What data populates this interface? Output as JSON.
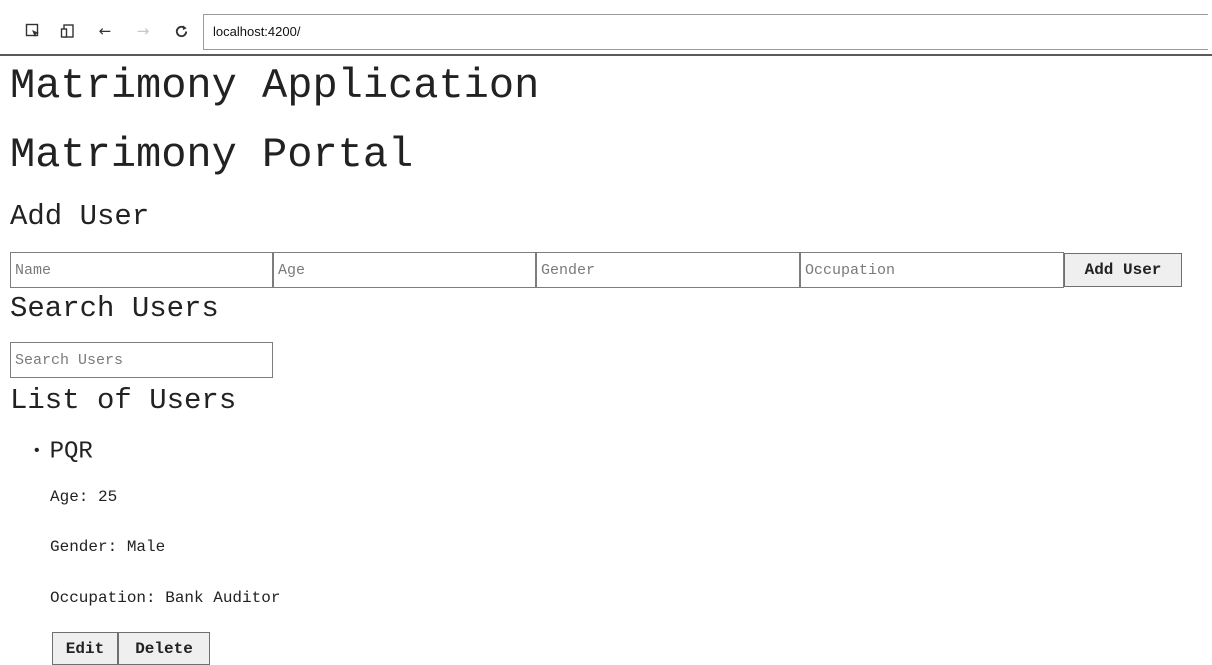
{
  "browser": {
    "url": "localhost:4200/",
    "icons": [
      "inspect-icon",
      "device-icon",
      "back-arrow-icon",
      "forward-arrow-icon",
      "reload-icon"
    ]
  },
  "app": {
    "title": "Matrimony Application",
    "portal_title": "Matrimony Portal"
  },
  "add_user": {
    "heading": "Add User",
    "name_placeholder": "Name",
    "age_placeholder": "Age",
    "gender_placeholder": "Gender",
    "occupation_placeholder": "Occupation",
    "button_label": "Add User"
  },
  "search": {
    "heading": "Search Users",
    "placeholder": "Search Users"
  },
  "list": {
    "heading": "List of Users",
    "users": [
      {
        "name": "PQR",
        "age": "Age: 25",
        "gender": "Gender: Male",
        "occupation": "Occupation: Bank Auditor",
        "edit_label": "Edit",
        "delete_label": "Delete"
      }
    ]
  }
}
